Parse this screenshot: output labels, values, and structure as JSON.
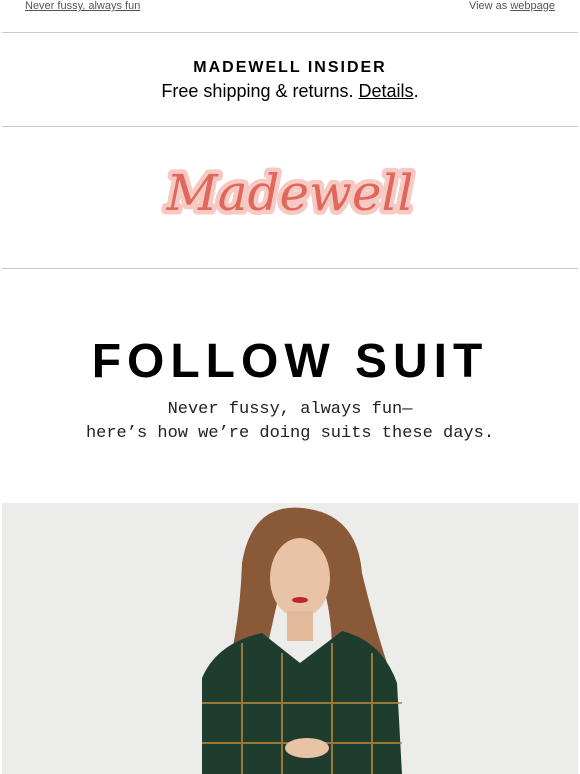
{
  "preheader": {
    "tagline": "Never fussy, always fun",
    "view_prefix": "View as",
    "view_link": "webpage"
  },
  "insider": {
    "title": "MADEWELL INSIDER",
    "subtitle": "Free shipping & returns.",
    "details_link": "Details",
    "period": "."
  },
  "brand": {
    "logo_text": "Madewell",
    "logo_color": "#e0675c",
    "logo_outline": "#f6c9c3"
  },
  "headline": "FOLLOW SUIT",
  "tagline": {
    "line1": "Never fussy, always fun—",
    "line2": "here’s how we’re doing suits these days."
  },
  "hero": {
    "background": "#ececea",
    "jacket_color": "#1f3d2f",
    "plaid_color": "#b8863a"
  }
}
